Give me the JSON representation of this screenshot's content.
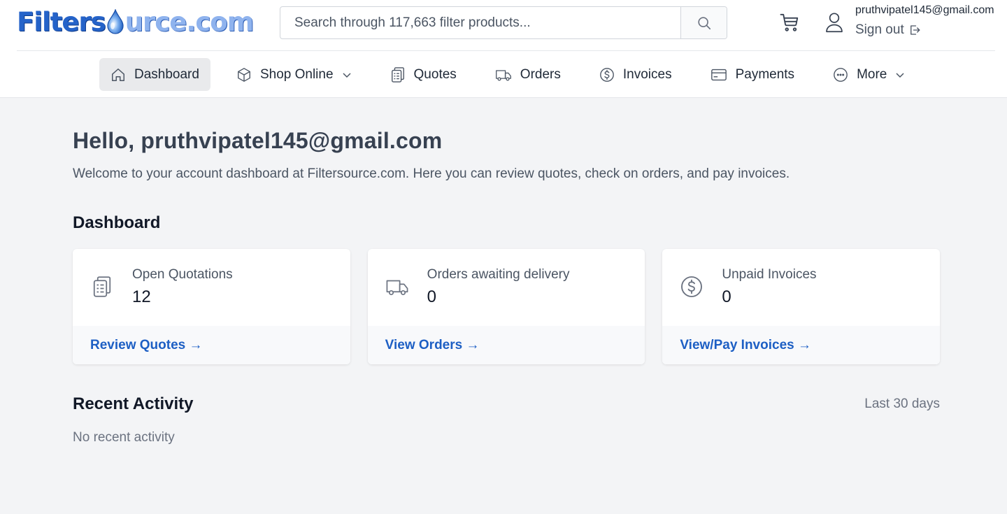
{
  "brand": {
    "part1": "Filters",
    "part2": "urce.com"
  },
  "search": {
    "placeholder": "Search through 117,663 filter products..."
  },
  "user": {
    "email": "pruthvipatel145@gmail.com",
    "signout_label": "Sign out"
  },
  "nav": {
    "items": [
      {
        "label": "Dashboard",
        "icon": "home-icon",
        "active": true
      },
      {
        "label": "Shop Online",
        "icon": "cube-icon",
        "dropdown": true
      },
      {
        "label": "Quotes",
        "icon": "clipboard-icon"
      },
      {
        "label": "Orders",
        "icon": "truck-icon"
      },
      {
        "label": "Invoices",
        "icon": "dollar-circle-icon"
      },
      {
        "label": "Payments",
        "icon": "credit-card-icon"
      },
      {
        "label": "More",
        "icon": "more-circle-icon",
        "dropdown": true
      }
    ]
  },
  "main": {
    "greeting": "Hello, pruthvipatel145@gmail.com",
    "welcome": "Welcome to your account dashboard at Filtersource.com. Here you can review quotes, check on orders, and pay invoices.",
    "dashboard_title": "Dashboard",
    "cards": [
      {
        "label": "Open Quotations",
        "value": "12",
        "link": "Review Quotes →",
        "icon": "clipboard-icon"
      },
      {
        "label": "Orders awaiting delivery",
        "value": "0",
        "link": "View Orders →",
        "icon": "truck-icon"
      },
      {
        "label": "Unpaid Invoices",
        "value": "0",
        "link": "View/Pay Invoices →",
        "icon": "dollar-circle-icon"
      }
    ],
    "activity": {
      "title": "Recent Activity",
      "range": "Last 30 days",
      "empty": "No recent activity"
    }
  },
  "colors": {
    "link": "#1d5fc4",
    "brand_dark": "#2563c9",
    "brand_light": "#8fb3ee",
    "page_bg": "#f3f4f6",
    "nav_active_bg": "#e9eaec"
  }
}
